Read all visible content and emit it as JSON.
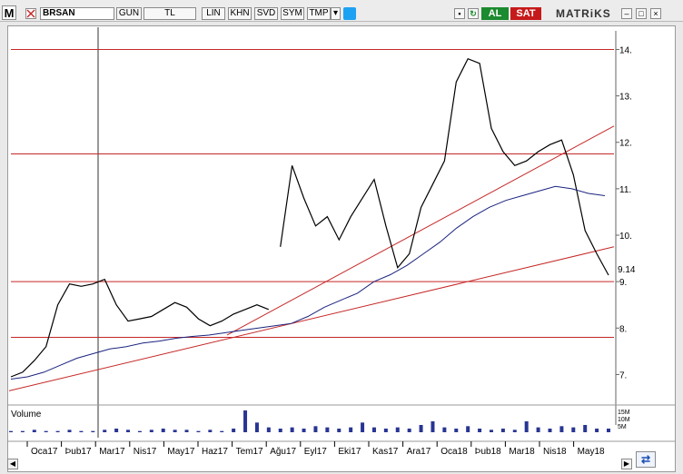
{
  "toolbar": {
    "logo": "M",
    "symbol": "BRSAN",
    "period": "GUN",
    "currency": "TL",
    "scale": "LIN",
    "buttons": [
      "KHN",
      "SVD",
      "SYM",
      "TMP"
    ],
    "buy": "AL",
    "sell": "SAT",
    "brand": "MATRiKS"
  },
  "colors": {
    "price": "#000000",
    "ma": "#1a237e",
    "levels": "#c62828",
    "trend": "#c62828",
    "volume": "#283593",
    "buy": "#1c8a2f",
    "sell": "#c61a1a"
  },
  "axis": {
    "price_ticks": [
      "14.",
      "13.",
      "12.",
      "11.",
      "10.",
      "9.",
      "8.",
      "7."
    ],
    "last_price": "9.14",
    "volume_label": "Volume",
    "volume_ticks": [
      "15M",
      "10M",
      "5M"
    ],
    "months": [
      "Oca17",
      "Þub17",
      "Mar17",
      "Nis17",
      "May17",
      "Haz17",
      "Tem17",
      "Ağu17",
      "Eyl17",
      "Eki17",
      "Kas17",
      "Ara17",
      "Oca18",
      "Þub18",
      "Mar18",
      "Nis18",
      "May18"
    ]
  },
  "chart_data": {
    "type": "line",
    "title": "BRSAN",
    "last_price": 9.14,
    "ylim": [
      6.5,
      14.4
    ],
    "horizontal_levels": [
      14.0,
      11.75,
      9.0,
      7.8
    ],
    "series": [
      {
        "values": [
          6.95,
          7.05,
          7.3,
          7.6,
          8.5,
          8.95,
          8.9,
          8.95,
          9.05,
          8.5,
          8.15,
          8.2,
          8.25,
          8.4,
          8.55,
          8.45,
          8.2,
          8.05,
          8.15,
          8.3,
          8.4,
          8.5,
          8.4,
          9.75,
          11.5,
          10.8,
          10.2,
          10.4,
          9.9,
          10.4,
          10.8,
          11.2,
          10.2,
          9.3,
          9.6,
          10.6,
          11.1,
          11.6,
          13.3,
          13.8,
          13.7,
          12.3,
          11.8,
          11.5,
          11.6,
          11.8,
          11.95,
          12.05,
          11.3,
          10.1,
          9.6,
          9.14
        ]
      },
      {
        "values": [
          6.9,
          6.95,
          7.05,
          7.2,
          7.35,
          7.45,
          7.55,
          7.6,
          7.68,
          7.72,
          7.78,
          7.82,
          7.85,
          7.9,
          7.95,
          8.0,
          8.05,
          8.1,
          8.25,
          8.45,
          8.6,
          8.75,
          9.0,
          9.15,
          9.35,
          9.6,
          9.85,
          10.15,
          10.4,
          10.6,
          10.75,
          10.85,
          10.95,
          11.05,
          11.0,
          10.9,
          10.85
        ]
      },
      {
        "values": [
          1,
          1,
          2,
          1,
          1,
          2,
          1,
          1,
          2,
          3,
          2,
          1,
          2,
          3,
          2,
          2,
          1,
          2,
          1,
          3,
          18,
          8,
          4,
          3,
          4,
          3,
          5,
          4,
          3,
          4,
          8,
          4,
          3,
          4,
          3,
          6,
          9,
          4,
          3,
          5,
          3,
          2,
          3,
          2,
          9,
          4,
          3,
          5,
          4,
          6,
          3,
          3
        ]
      }
    ]
  }
}
